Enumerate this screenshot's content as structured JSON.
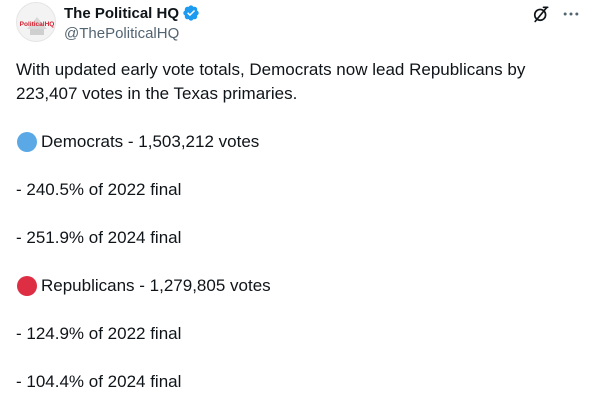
{
  "post": {
    "author": {
      "display_name": "The Political HQ",
      "handle": "@ThePoliticalHQ",
      "verified_icon": "verified-badge-icon",
      "verified_color": "#1d9bf0",
      "avatar_logo_text": "PoliticalHQ"
    },
    "actions": {
      "grok_icon": "grok-icon",
      "more_icon": "more-icon",
      "more_glyph": "···"
    },
    "intro": "With updated early vote totals, Democrats now lead Republicans by 223,407 votes in the Texas primaries.",
    "lines": [
      {
        "text": "Democrats - 1,503,212 votes",
        "dot_color": "#5aa9e6",
        "icon": "blue-circle-icon"
      },
      {
        "text": "- 240.5% of 2022 final"
      },
      {
        "text": "- 251.9% of 2024 final"
      },
      {
        "text": "Republicans - 1,279,805 votes",
        "dot_color": "#dd2e44",
        "icon": "red-circle-icon"
      },
      {
        "text": "- 124.9% of 2022 final"
      },
      {
        "text": "- 104.4% of 2024 final"
      }
    ]
  }
}
